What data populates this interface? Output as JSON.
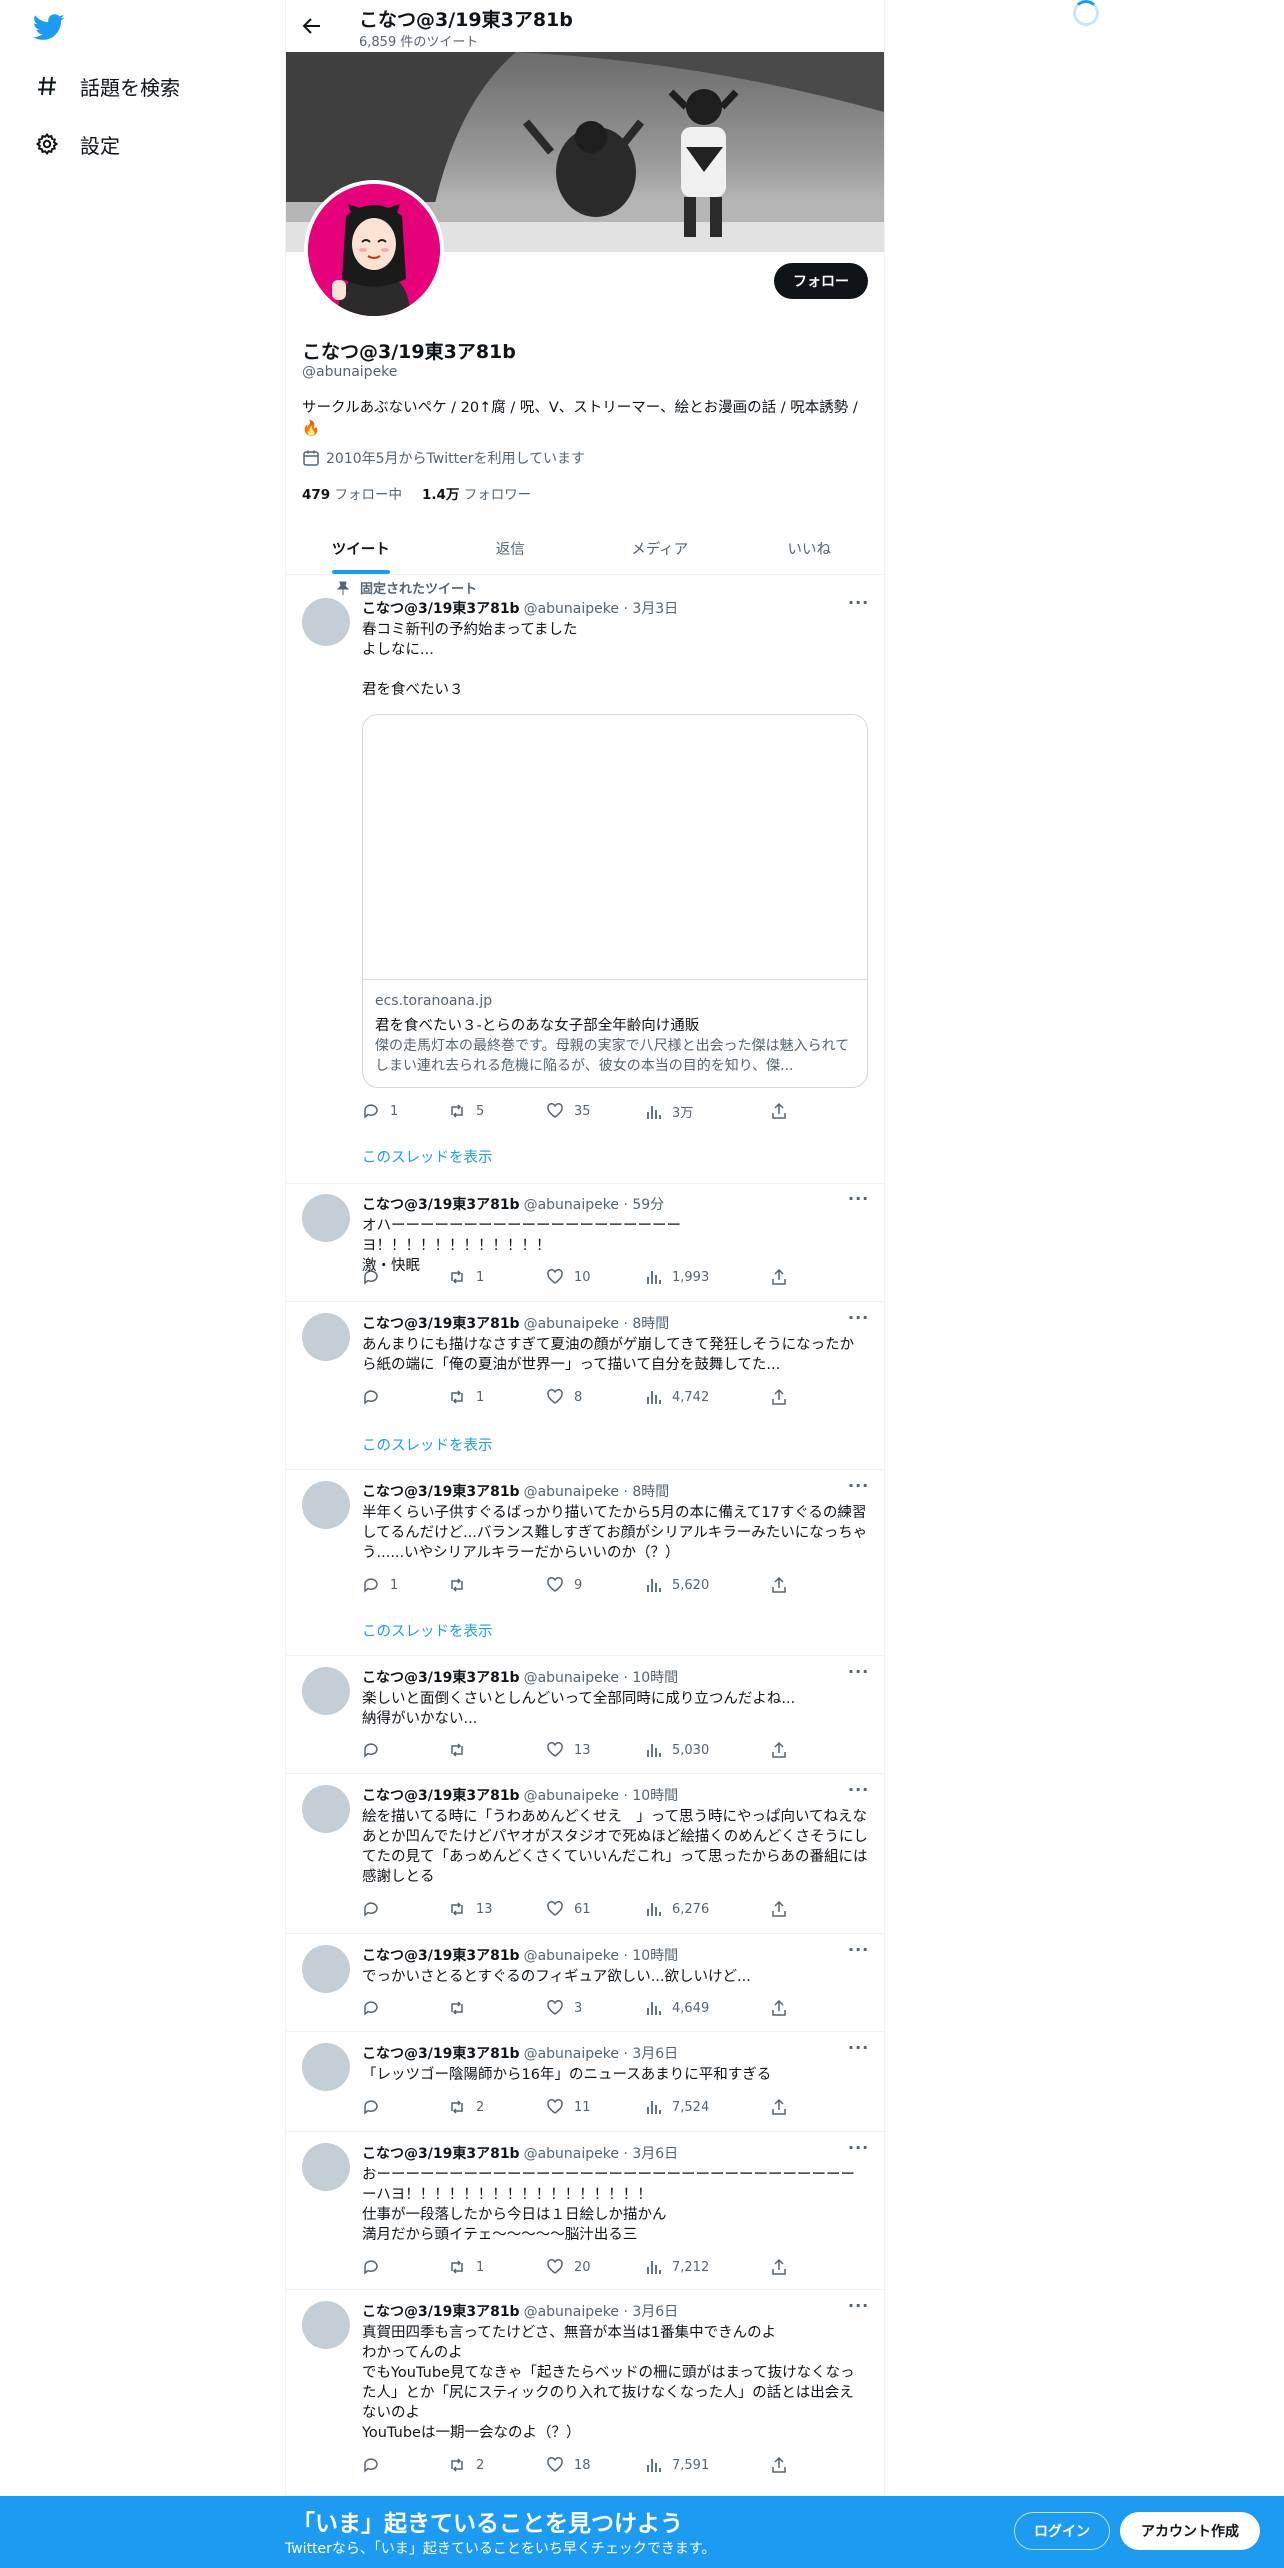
{
  "nav": {
    "logo_icon": "twitter-bird-icon",
    "items": [
      {
        "icon": "hashtag-icon",
        "label": "話題を検索"
      },
      {
        "icon": "gear-icon",
        "label": "設定"
      }
    ]
  },
  "header": {
    "title": "こなつ@3/19東3ア81b",
    "subtitle": "6,859 件のツイート"
  },
  "profile": {
    "name": "こなつ@3/19東3ア81b",
    "handle": "@abunaipeke",
    "bio": "サークルあぶないペケ / 20↑腐 / 呪、V、ストリーマー、絵とお漫画の話 / 呪本誘勢 / 🔥",
    "joined": "2010年5月からTwitterを利用しています",
    "following_count": "479",
    "following_label": "フォロー中",
    "followers_count": "1.4万",
    "followers_label": "フォロワー",
    "follow_button": "フォロー"
  },
  "tabs": [
    "ツイート",
    "返信",
    "メディア",
    "いいね"
  ],
  "pinned_label": "固定されたツイート",
  "thread_link": "このスレッドを表示",
  "card": {
    "domain": "ecs.toranoana.jp",
    "title": "君を食べたい３-とらのあな女子部全年齢向け通販",
    "desc": "傑の走馬灯本の最終巻です。母親の実家で八尺様と出会った傑は魅入られてしまい連れ去られる危機に陥るが、彼女の本当の目的を知り、傑..."
  },
  "tweets": [
    {
      "name": "こなつ@3/19東3ア81b",
      "meta": "@abunaipeke · 3月3日",
      "text": "春コミ新刊の予約始まってました\nよしなに...\n\n君を食べたい３",
      "reply": "1",
      "retweet": "5",
      "like": "35",
      "views": "3万"
    },
    {
      "name": "こなつ@3/19東3ア81b",
      "meta": "@abunaipeke · 59分",
      "text": "オハーーーーーーーーーーーーーーーーーーーーヨ！！！！！！！！！！！！\n激・快眠",
      "reply": "",
      "retweet": "1",
      "like": "10",
      "views": "1,993"
    },
    {
      "name": "こなつ@3/19東3ア81b",
      "meta": "@abunaipeke · 8時間",
      "text": "あんまりにも描けなさすぎて夏油の顔がゲ崩してきて発狂しそうになったから紙の端に「俺の夏油が世界一」って描いて自分を鼓舞してた...",
      "reply": "",
      "retweet": "1",
      "like": "8",
      "views": "4,742"
    },
    {
      "name": "こなつ@3/19東3ア81b",
      "meta": "@abunaipeke · 8時間",
      "text": "半年くらい子供すぐるばっかり描いてたから5月の本に備えて17すぐるの練習してるんだけど...バランス難しすぎてお顔がシリアルキラーみたいになっちゃう......いやシリアルキラーだからいいのか（？）",
      "reply": "1",
      "retweet": "",
      "like": "9",
      "views": "5,620"
    },
    {
      "name": "こなつ@3/19東3ア81b",
      "meta": "@abunaipeke · 10時間",
      "text": "楽しいと面倒くさいとしんどいって全部同時に成り立つんだよね...\n納得がいかない...",
      "reply": "",
      "retweet": "",
      "like": "13",
      "views": "5,030"
    },
    {
      "name": "こなつ@3/19東3ア81b",
      "meta": "@abunaipeke · 10時間",
      "text": "絵を描いてる時に「うわあめんどくせえ　」って思う時にやっぱ向いてねえなあとか凹んでたけどパヤオがスタジオで死ぬほど絵描くのめんどくさそうにしてたの見て「あっめんどくさくていいんだこれ」って思ったからあの番組には感謝しとる",
      "reply": "",
      "retweet": "13",
      "like": "61",
      "views": "6,276"
    },
    {
      "name": "こなつ@3/19東3ア81b",
      "meta": "@abunaipeke · 10時間",
      "text": "でっかいさとるとすぐるのフィギュア欲しい...欲しいけど...",
      "reply": "",
      "retweet": "",
      "like": "3",
      "views": "4,649"
    },
    {
      "name": "こなつ@3/19東3ア81b",
      "meta": "@abunaipeke · 3月6日",
      "text": "「レッツゴー陰陽師から16年」のニュースあまりに平和すぎる",
      "reply": "",
      "retweet": "2",
      "like": "11",
      "views": "7,524"
    },
    {
      "name": "こなつ@3/19東3ア81b",
      "meta": "@abunaipeke · 3月6日",
      "text": "おーーーーーーーーーーーーーーーーーーーーーーーーーーーーーーーーーーハヨ！！！！！！！！！！！！！！！！！\n仕事が一段落したから今日は１日絵しか描かん\n満月だから頭イテェ〜〜〜〜〜脳汁出る三",
      "reply": "",
      "retweet": "1",
      "like": "20",
      "views": "7,212"
    },
    {
      "name": "こなつ@3/19東3ア81b",
      "meta": "@abunaipeke · 3月6日",
      "text": "真賀田四季も言ってたけどさ、無音が本当は1番集中できんのよ\nわかってんのよ\nでもYouTube見てなきゃ「起きたらベッドの柵に頭がはまって抜けなくなった人」とか「尻にスティックのり入れて抜けなくなった人」の話とは出会えないのよ\nYouTubeは一期一会なのよ（？）",
      "reply": "",
      "retweet": "2",
      "like": "18",
      "views": "7,591"
    }
  ],
  "bottom_bar": {
    "title": "「いま」起きていることを見つけよう",
    "subtitle": "Twitterなら、「いま」起きていることをいち早くチェックできます。",
    "login": "ログイン",
    "signup": "アカウント作成"
  }
}
